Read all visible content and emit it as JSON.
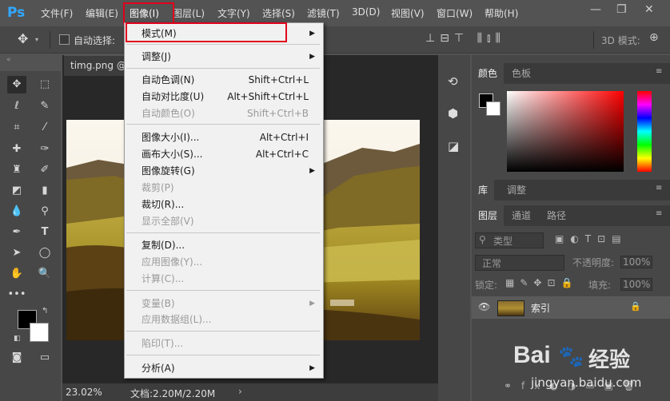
{
  "app": {
    "logo": "Ps",
    "menus": [
      "文件(F)",
      "编辑(E)",
      "图像(I)",
      "图层(L)",
      "文字(Y)",
      "选择(S)",
      "滤镜(T)",
      "3D(D)",
      "视图(V)",
      "窗口(W)",
      "帮助(H)"
    ],
    "active_menu": "图像(I)",
    "window_controls": [
      "—",
      "❐",
      "✕"
    ]
  },
  "options_bar": {
    "auto_select_label": "自动选择:",
    "mode_3d_label": "3D 模式:"
  },
  "document": {
    "tab_title": "timg.png @",
    "zoom": "23.02%",
    "doc_info": "文档:2.20M/2.20M"
  },
  "image_menu": {
    "items": [
      {
        "label": "模式(M)",
        "shortcut": "",
        "submenu": true,
        "disabled": false
      },
      {
        "label": "调整(J)",
        "shortcut": "",
        "submenu": true,
        "disabled": false
      },
      {
        "label": "自动色调(N)",
        "shortcut": "Shift+Ctrl+L",
        "submenu": false,
        "disabled": false
      },
      {
        "label": "自动对比度(U)",
        "shortcut": "Alt+Shift+Ctrl+L",
        "submenu": false,
        "disabled": false
      },
      {
        "label": "自动颜色(O)",
        "shortcut": "Shift+Ctrl+B",
        "submenu": false,
        "disabled": true
      },
      {
        "label": "图像大小(I)...",
        "shortcut": "Alt+Ctrl+I",
        "submenu": false,
        "disabled": false
      },
      {
        "label": "画布大小(S)...",
        "shortcut": "Alt+Ctrl+C",
        "submenu": false,
        "disabled": false
      },
      {
        "label": "图像旋转(G)",
        "shortcut": "",
        "submenu": true,
        "disabled": false
      },
      {
        "label": "裁剪(P)",
        "shortcut": "",
        "submenu": false,
        "disabled": true
      },
      {
        "label": "裁切(R)...",
        "shortcut": "",
        "submenu": false,
        "disabled": false
      },
      {
        "label": "显示全部(V)",
        "shortcut": "",
        "submenu": false,
        "disabled": true
      },
      {
        "label": "复制(D)...",
        "shortcut": "",
        "submenu": false,
        "disabled": false
      },
      {
        "label": "应用图像(Y)...",
        "shortcut": "",
        "submenu": false,
        "disabled": true
      },
      {
        "label": "计算(C)...",
        "shortcut": "",
        "submenu": false,
        "disabled": true
      },
      {
        "label": "变量(B)",
        "shortcut": "",
        "submenu": true,
        "disabled": true
      },
      {
        "label": "应用数据组(L)...",
        "shortcut": "",
        "submenu": false,
        "disabled": true
      },
      {
        "label": "陷印(T)...",
        "shortcut": "",
        "submenu": false,
        "disabled": true
      },
      {
        "label": "分析(A)",
        "shortcut": "",
        "submenu": true,
        "disabled": false
      }
    ],
    "submenu_arrow": "▶"
  },
  "color_panel": {
    "tabs": [
      "颜色",
      "色板"
    ],
    "active_tab": "颜色",
    "hue_color": "#ff0000"
  },
  "library_panel": {
    "tabs": [
      "库",
      "调整"
    ]
  },
  "layers_panel": {
    "tabs": [
      "图层",
      "通道",
      "路径"
    ],
    "filter_label": "类型",
    "blend_mode": "正常",
    "opacity_label": "不透明度:",
    "opacity_value": "100%",
    "lock_label": "锁定:",
    "fill_label": "填充:",
    "fill_value": "100%",
    "layer_name": "索引",
    "lock_icon": "🔒"
  },
  "watermark": {
    "brand": "Bai",
    "brand2": "经验",
    "url": "jingyan.baidu.com"
  }
}
